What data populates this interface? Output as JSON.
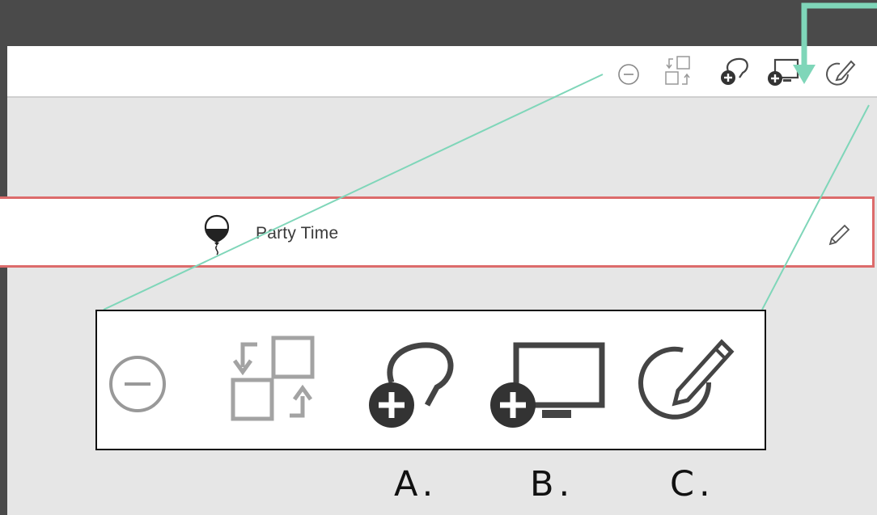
{
  "row": {
    "title": "Party Time",
    "icon": "balloon-icon",
    "edit_icon": "pencil-icon"
  },
  "toolbar": {
    "icons": [
      "remove-circle-icon",
      "swap-layout-icon",
      "add-speech-bubble-icon",
      "add-display-icon",
      "edit-circle-icon"
    ]
  },
  "callouts": {
    "a": "A.",
    "b": "B.",
    "c": "C."
  },
  "colors": {
    "accent": "#7fd6b9",
    "row_border": "#dc6b6b",
    "topbar": "#4a4a4a",
    "canvas": "#e6e6e6"
  }
}
